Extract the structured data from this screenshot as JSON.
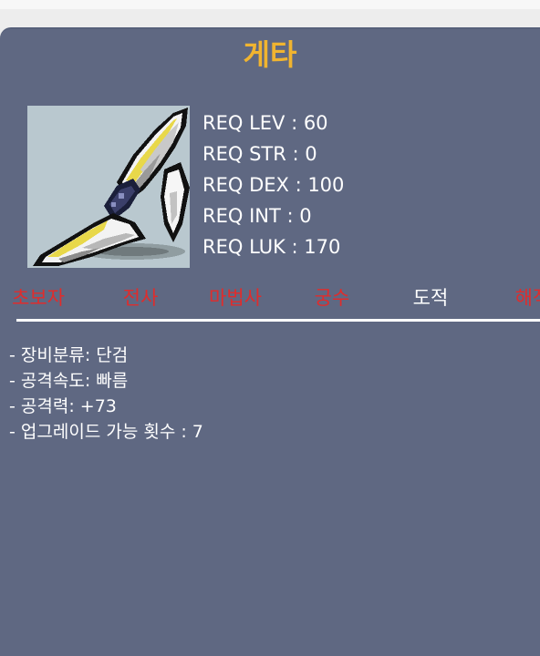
{
  "item": {
    "name": "게타",
    "icon": "dagger-icon",
    "colors": {
      "title": "#f0b430",
      "panel": "#5f6882",
      "job_available": "#ffffff",
      "job_unavailable": "#e02c2c"
    }
  },
  "requirements": [
    "REQ LEV : 60",
    "REQ STR : 0",
    "REQ DEX : 100",
    "REQ INT : 0",
    "REQ LUK : 170"
  ],
  "jobs": [
    {
      "label": "초보자",
      "available": false
    },
    {
      "label": "전사",
      "available": false
    },
    {
      "label": "마법사",
      "available": false
    },
    {
      "label": "궁수",
      "available": false
    },
    {
      "label": "도적",
      "available": true
    },
    {
      "label": "해적",
      "available": false
    }
  ],
  "stats": [
    "- 장비분류: 단검",
    "- 공격속도: 빠름",
    "- 공격력: +73",
    "- 업그레이드 가능 횟수 : 7"
  ]
}
